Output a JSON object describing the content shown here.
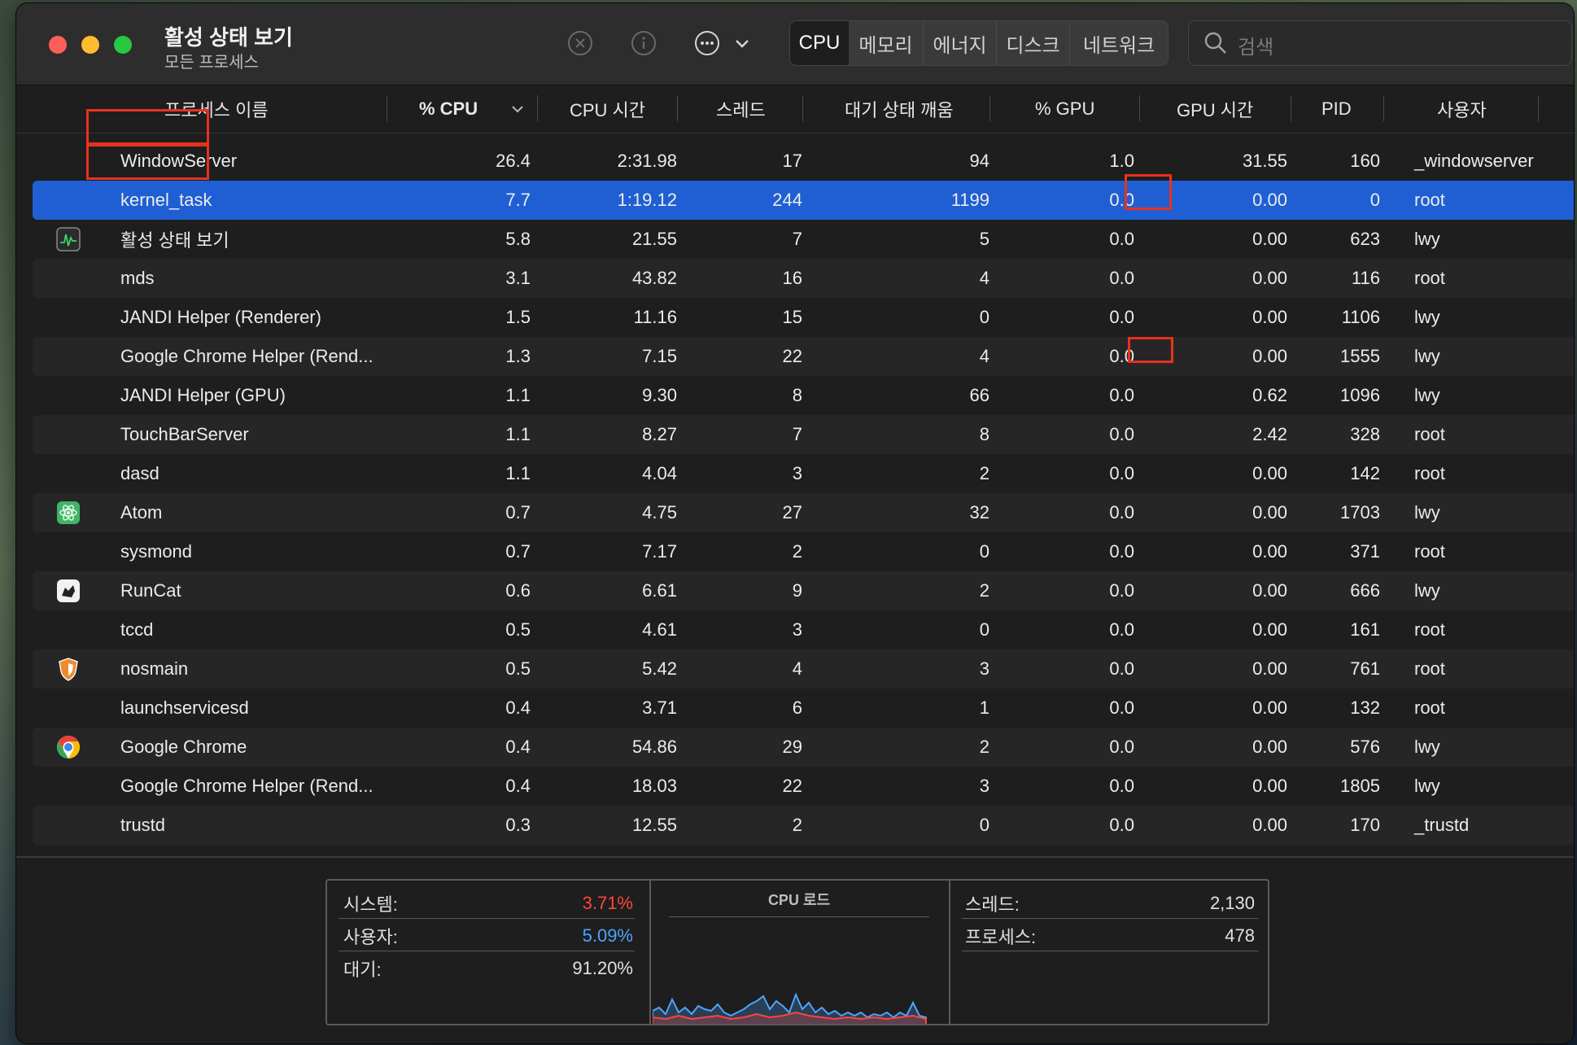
{
  "window": {
    "title": "활성 상태 보기",
    "subtitle": "모든 프로세스"
  },
  "toolbar": {
    "stop_icon": "xmark-circle-icon",
    "info_icon": "info-circle-icon",
    "more_icon": "ellipsis-circle-icon",
    "tabs": [
      "CPU",
      "메모리",
      "에너지",
      "디스크",
      "네트워크"
    ],
    "active_tab": "CPU",
    "search_placeholder": "검색"
  },
  "columns": [
    "프로세스 이름",
    "% CPU",
    "CPU 시간",
    "스레드",
    "대기 상태 깨움",
    "% GPU",
    "GPU 시간",
    "PID",
    "사용자"
  ],
  "sort": {
    "column": "% CPU",
    "direction": "descending"
  },
  "rows": [
    {
      "name": "WindowServer",
      "icon": "",
      "cpu": "26.4",
      "cpu_time": "2:31.98",
      "threads": "17",
      "wakeups": "94",
      "gpu": "1.0",
      "gpu_time": "31.55",
      "pid": "160",
      "user": "_windowserver"
    },
    {
      "name": "kernel_task",
      "icon": "",
      "cpu": "7.7",
      "cpu_time": "1:19.12",
      "threads": "244",
      "wakeups": "1199",
      "gpu": "0.0",
      "gpu_time": "0.00",
      "pid": "0",
      "user": "root"
    },
    {
      "name": "활성 상태 보기",
      "icon": "activity-monitor-icon",
      "cpu": "5.8",
      "cpu_time": "21.55",
      "threads": "7",
      "wakeups": "5",
      "gpu": "0.0",
      "gpu_time": "0.00",
      "pid": "623",
      "user": "lwy"
    },
    {
      "name": "mds",
      "icon": "",
      "cpu": "3.1",
      "cpu_time": "43.82",
      "threads": "16",
      "wakeups": "4",
      "gpu": "0.0",
      "gpu_time": "0.00",
      "pid": "116",
      "user": "root"
    },
    {
      "name": "JANDI Helper (Renderer)",
      "icon": "",
      "cpu": "1.5",
      "cpu_time": "11.16",
      "threads": "15",
      "wakeups": "0",
      "gpu": "0.0",
      "gpu_time": "0.00",
      "pid": "1106",
      "user": "lwy"
    },
    {
      "name": "Google Chrome Helper (Rend...",
      "icon": "",
      "cpu": "1.3",
      "cpu_time": "7.15",
      "threads": "22",
      "wakeups": "4",
      "gpu": "0.0",
      "gpu_time": "0.00",
      "pid": "1555",
      "user": "lwy"
    },
    {
      "name": "JANDI Helper (GPU)",
      "icon": "",
      "cpu": "1.1",
      "cpu_time": "9.30",
      "threads": "8",
      "wakeups": "66",
      "gpu": "0.0",
      "gpu_time": "0.62",
      "pid": "1096",
      "user": "lwy"
    },
    {
      "name": "TouchBarServer",
      "icon": "",
      "cpu": "1.1",
      "cpu_time": "8.27",
      "threads": "7",
      "wakeups": "8",
      "gpu": "0.0",
      "gpu_time": "2.42",
      "pid": "328",
      "user": "root"
    },
    {
      "name": "dasd",
      "icon": "",
      "cpu": "1.1",
      "cpu_time": "4.04",
      "threads": "3",
      "wakeups": "2",
      "gpu": "0.0",
      "gpu_time": "0.00",
      "pid": "142",
      "user": "root"
    },
    {
      "name": "Atom",
      "icon": "atom-icon",
      "cpu": "0.7",
      "cpu_time": "4.75",
      "threads": "27",
      "wakeups": "32",
      "gpu": "0.0",
      "gpu_time": "0.00",
      "pid": "1703",
      "user": "lwy"
    },
    {
      "name": "sysmond",
      "icon": "",
      "cpu": "0.7",
      "cpu_time": "7.17",
      "threads": "2",
      "wakeups": "0",
      "gpu": "0.0",
      "gpu_time": "0.00",
      "pid": "371",
      "user": "root"
    },
    {
      "name": "RunCat",
      "icon": "runcat-icon",
      "cpu": "0.6",
      "cpu_time": "6.61",
      "threads": "9",
      "wakeups": "2",
      "gpu": "0.0",
      "gpu_time": "0.00",
      "pid": "666",
      "user": "lwy"
    },
    {
      "name": "tccd",
      "icon": "",
      "cpu": "0.5",
      "cpu_time": "4.61",
      "threads": "3",
      "wakeups": "0",
      "gpu": "0.0",
      "gpu_time": "0.00",
      "pid": "161",
      "user": "root"
    },
    {
      "name": "nosmain",
      "icon": "shield-icon",
      "cpu": "0.5",
      "cpu_time": "5.42",
      "threads": "4",
      "wakeups": "3",
      "gpu": "0.0",
      "gpu_time": "0.00",
      "pid": "761",
      "user": "root"
    },
    {
      "name": "launchservicesd",
      "icon": "",
      "cpu": "0.4",
      "cpu_time": "3.71",
      "threads": "6",
      "wakeups": "1",
      "gpu": "0.0",
      "gpu_time": "0.00",
      "pid": "132",
      "user": "root"
    },
    {
      "name": "Google Chrome",
      "icon": "chrome-icon",
      "cpu": "0.4",
      "cpu_time": "54.86",
      "threads": "29",
      "wakeups": "2",
      "gpu": "0.0",
      "gpu_time": "0.00",
      "pid": "576",
      "user": "lwy"
    },
    {
      "name": "Google Chrome Helper (Rend...",
      "icon": "",
      "cpu": "0.4",
      "cpu_time": "18.03",
      "threads": "22",
      "wakeups": "3",
      "gpu": "0.0",
      "gpu_time": "0.00",
      "pid": "1805",
      "user": "lwy"
    },
    {
      "name": "trustd",
      "icon": "",
      "cpu": "0.3",
      "cpu_time": "12.55",
      "threads": "2",
      "wakeups": "0",
      "gpu": "0.0",
      "gpu_time": "0.00",
      "pid": "170",
      "user": "_trustd"
    }
  ],
  "selected_row": "kernel_task",
  "footer": {
    "system_label": "시스템:",
    "system_value": "3.71%",
    "user_label": "사용자:",
    "user_value": "5.09%",
    "idle_label": "대기:",
    "idle_value": "91.20%",
    "chart_title": "CPU 로드",
    "threads_label": "스레드:",
    "threads_value": "2,130",
    "processes_label": "프로세스:",
    "processes_value": "478"
  },
  "colors": {
    "selection": "#1f5fd3",
    "system_red": "#ff453a",
    "user_blue": "#4fa3ff",
    "highlight_box": "#e8321e"
  }
}
